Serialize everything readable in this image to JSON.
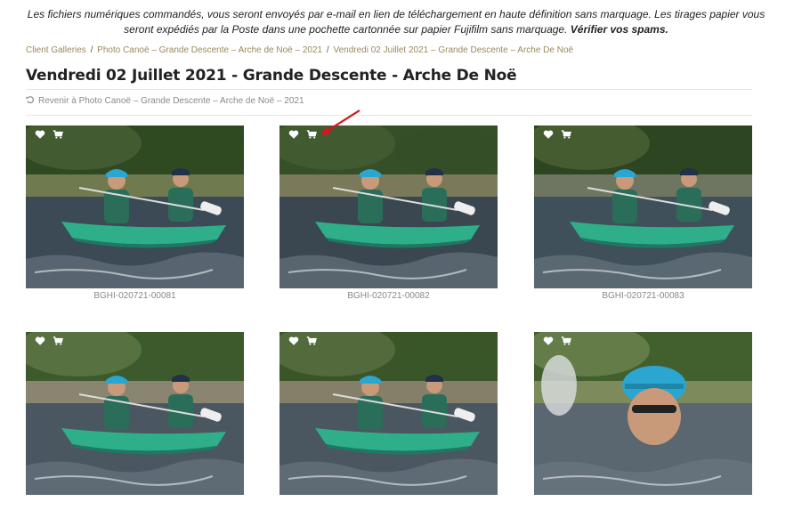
{
  "notice": {
    "text": "Les fichiers numériques commandés, vous seront envoyés par e-mail en lien de téléchargement en haute définition sans marquage. Les tirages papier vous seront expédiés par la Poste dans une pochette cartonnée sur papier Fujifilm sans marquage.",
    "bold": "Vérifier vos spams."
  },
  "breadcrumb": {
    "items": [
      "Client Galleries",
      "Photo Canoë – Grande Descente – Arche de Noë – 2021",
      "Vendredi 02 Juillet 2021 – Grande Descente – Arche De Noë"
    ],
    "separator": "/"
  },
  "page": {
    "title": "Vendredi 02 Juillet 2021 - Grande Descente - Arche De Noë",
    "back_label": "Revenir à Photo Canoë – Grande Descente – Arche de Noë – 2021"
  },
  "gallery": {
    "icons": [
      "heart-icon",
      "cart-icon"
    ],
    "photos": [
      {
        "caption": "BGHI-020721-00081"
      },
      {
        "caption": "BGHI-020721-00082"
      },
      {
        "caption": "BGHI-020721-00083"
      },
      {
        "caption": ""
      },
      {
        "caption": ""
      },
      {
        "caption": ""
      }
    ]
  },
  "colors": {
    "link": "#9a8a5a",
    "annotation_arrow": "#d9141b",
    "canoe": "#2fae8a"
  }
}
